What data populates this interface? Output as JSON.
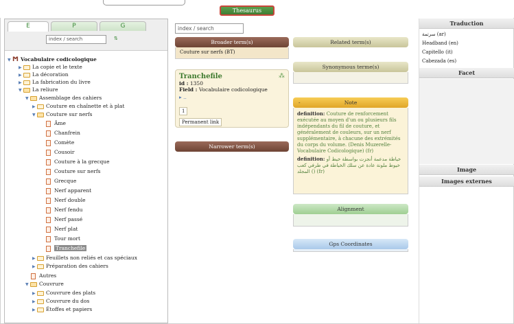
{
  "thesaurus_button": "Thesaurus",
  "left": {
    "tabs": [
      "E",
      "P",
      "G"
    ],
    "search_placeholder": "index / search",
    "sort_icon": "sort-az-icon",
    "tree": {
      "root": "Vocabulaire codicologique",
      "n1": "La copie et le texte",
      "n2": "La décoration",
      "n3": "La fabrication du livre",
      "n4": "La reliure",
      "n5": "Assemblage des cahiers",
      "n6": "Couture en chaînette et à plat",
      "n7": "Couture sur nerfs",
      "l1": "Âme",
      "l2": "Chanfrein",
      "l3": "Comète",
      "l4": "Cousoir",
      "l5": "Couture à la grecque",
      "l6": "Couture sur nerfs",
      "l7": "Grecque",
      "l8": "Nerf apparent",
      "l9": "Nerf double",
      "l10": "Nerf fendu",
      "l11": "Nerf passé",
      "l12": "Nerf plat",
      "l13": "Tour mort",
      "l14": "Tranchefile",
      "n8": "Feuillets non reliés et cas spéciaux",
      "n9": "Préparation des cahiers",
      "n10": "Autres",
      "n11": "Couvrure",
      "n12": "Couvrure des plats",
      "n13": "Couvrure du dos",
      "n14": "Étoffes et papiers"
    }
  },
  "center": {
    "search_placeholder": "index / search",
    "broader_header": "Broader term(s)",
    "broader_value": "Couture sur nerfs (BT)",
    "card": {
      "title": "Tranchefile",
      "id_label": "id :",
      "id_value": "1350",
      "field_label": "Field :",
      "field_value": "Vocabulaire codicologique",
      "expander": "▸ ..",
      "count": "1",
      "permanent_link": "Permanent link"
    },
    "narrower_header": "Narrower term(s)",
    "related_header": "Related term(s)",
    "synonymous_header": "Synonymous terme(s)",
    "note_header": "Note",
    "note_collapse": "-",
    "note": {
      "def_label_fr": "definition:",
      "def_fr": "Couture de renforcement exécutée au moyen d'un ou plusieurs fils indépendants du fil de couture, et généralement de couleurs, sur un nerf supplémentaire, à chacune des extrémités du corps du volume. (Denis Muzerelle-Vocabulaire Codicologique) (fr)",
      "def_label_ar": "definition:",
      "def_ar": "خياطة مدعمة أنجزت بواسطة خيط أو خيوط ملونة عادة عن سلك الخياطة في طرفي كعب المجلد () (fr)"
    },
    "alignment_header": "Alignment",
    "gps_header": "Gps Coordinates"
  },
  "right": {
    "traduction_header": "Traduction",
    "translations": [
      "سرتمة (ar)",
      "Headband (en)",
      "Capitello (it)",
      "Cabezada (es)"
    ],
    "facet_header": "Facet",
    "image_header": "Image",
    "images_ext_header": "Images externes"
  },
  "colors": {
    "brand_green": "#4a8f3f",
    "broader_brown": "#7a5040",
    "note_gold": "#e9b53a",
    "alignment_green": "#a8d49b",
    "gps_blue": "#b2cfee"
  }
}
